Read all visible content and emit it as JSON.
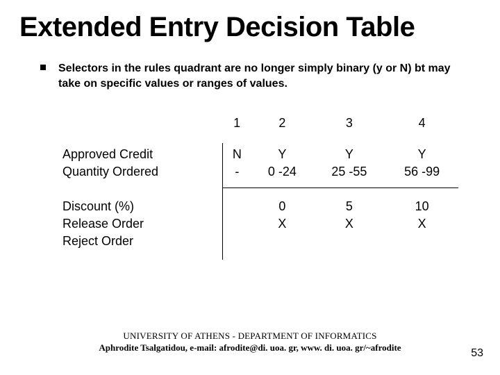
{
  "title": "Extended Entry Decision Table",
  "bullet": "Selectors in the rules quadrant are no longer simply binary (y or N) bt may take on specific values or ranges of values.",
  "chart_data": {
    "type": "table",
    "columns": [
      "1",
      "2",
      "3",
      "4"
    ],
    "conditions": [
      {
        "label": "Approved Credit",
        "values": [
          "N",
          "Y",
          "Y",
          "Y"
        ]
      },
      {
        "label": "Quantity Ordered",
        "values": [
          "-",
          "0 -24",
          "25 -55",
          "56 -99"
        ]
      }
    ],
    "actions": [
      {
        "label": "Discount (%)",
        "values": [
          "",
          "0",
          "5",
          "10"
        ]
      },
      {
        "label": "Release Order",
        "values": [
          "",
          "X",
          "X",
          "X"
        ]
      },
      {
        "label": "Reject Order",
        "values": [
          "",
          "",
          "",
          ""
        ]
      }
    ]
  },
  "footer": {
    "line1": "UNIVERSITY OF ATHENS - DEPARTMENT OF INFORMATICS",
    "line2": "Aphrodite Tsalgatidou, e-mail: afrodite@di. uoa. gr, www. di. uoa. gr/~afrodite"
  },
  "page_number": "53"
}
